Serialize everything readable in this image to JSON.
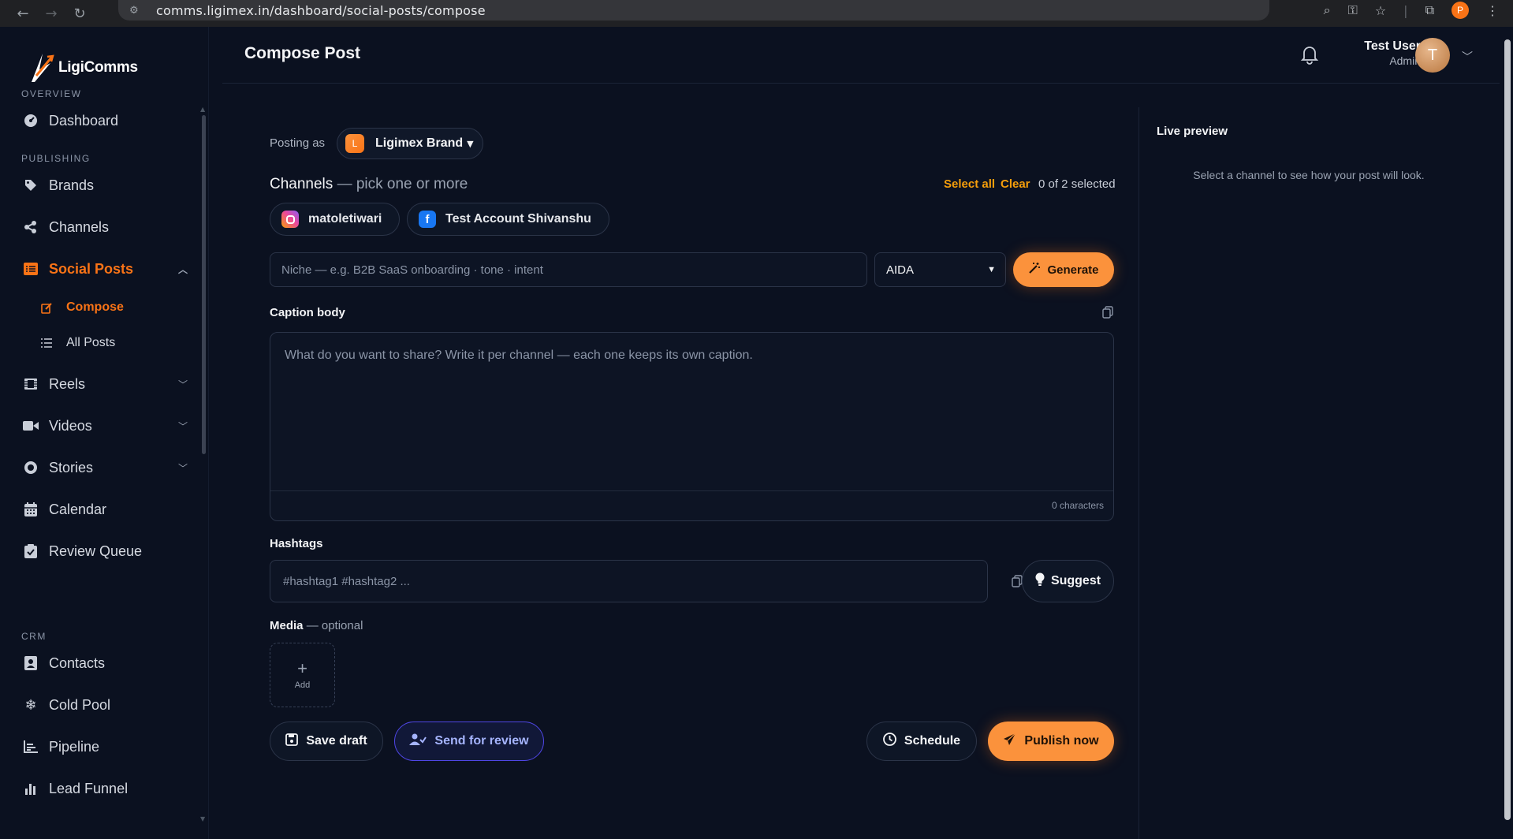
{
  "browser": {
    "url": "comms.ligimex.in/dashboard/social-posts/compose",
    "profile_initial": "P"
  },
  "app": {
    "name": "LigiComms"
  },
  "sidebar": {
    "sections": {
      "overview": "OVERVIEW",
      "publishing": "PUBLISHING",
      "crm": "CRM"
    },
    "items": {
      "dashboard": "Dashboard",
      "brands": "Brands",
      "channels": "Channels",
      "social_posts": "Social Posts",
      "compose": "Compose",
      "all_posts": "All Posts",
      "reels": "Reels",
      "videos": "Videos",
      "stories": "Stories",
      "calendar": "Calendar",
      "review_queue": "Review Queue",
      "contacts": "Contacts",
      "cold_pool": "Cold Pool",
      "pipeline": "Pipeline",
      "lead_funnel": "Lead Funnel"
    }
  },
  "header": {
    "title": "Compose Post",
    "user": {
      "name": "Test User",
      "role": "Admin",
      "initial": "T"
    }
  },
  "composer": {
    "posting_as_label": "Posting as",
    "brand": {
      "initial": "L",
      "name": "Ligimex Brand"
    },
    "channels_title": "Channels",
    "channels_subtitle": "— pick one or more",
    "select_all": "Select all",
    "clear": "Clear",
    "selected_count": "0 of 2 selected",
    "channels": [
      {
        "platform": "instagram",
        "name": "matoletiwari"
      },
      {
        "platform": "facebook",
        "name": "Test Account Shivanshu"
      }
    ],
    "niche_placeholder": "Niche — e.g. B2B SaaS onboarding · tone · intent",
    "framework": "AIDA",
    "generate_label": "Generate",
    "caption_label": "Caption body",
    "caption_placeholder": "What do you want to share? Write it per channel — each one keeps its own caption.",
    "char_count": "0 characters",
    "hashtags_label": "Hashtags",
    "hashtags_placeholder": "#hashtag1 #hashtag2 ...",
    "suggest_label": "Suggest",
    "media_label": "Media",
    "media_optional": "— optional",
    "add_label": "Add",
    "actions": {
      "save_draft": "Save draft",
      "send_review": "Send for review",
      "schedule": "Schedule",
      "publish": "Publish now"
    }
  },
  "preview": {
    "title": "Live preview",
    "hint": "Select a channel to see how your post will look."
  },
  "colors": {
    "accent": "#f97316",
    "background": "#0b1120",
    "review": "#a5b4fc"
  }
}
